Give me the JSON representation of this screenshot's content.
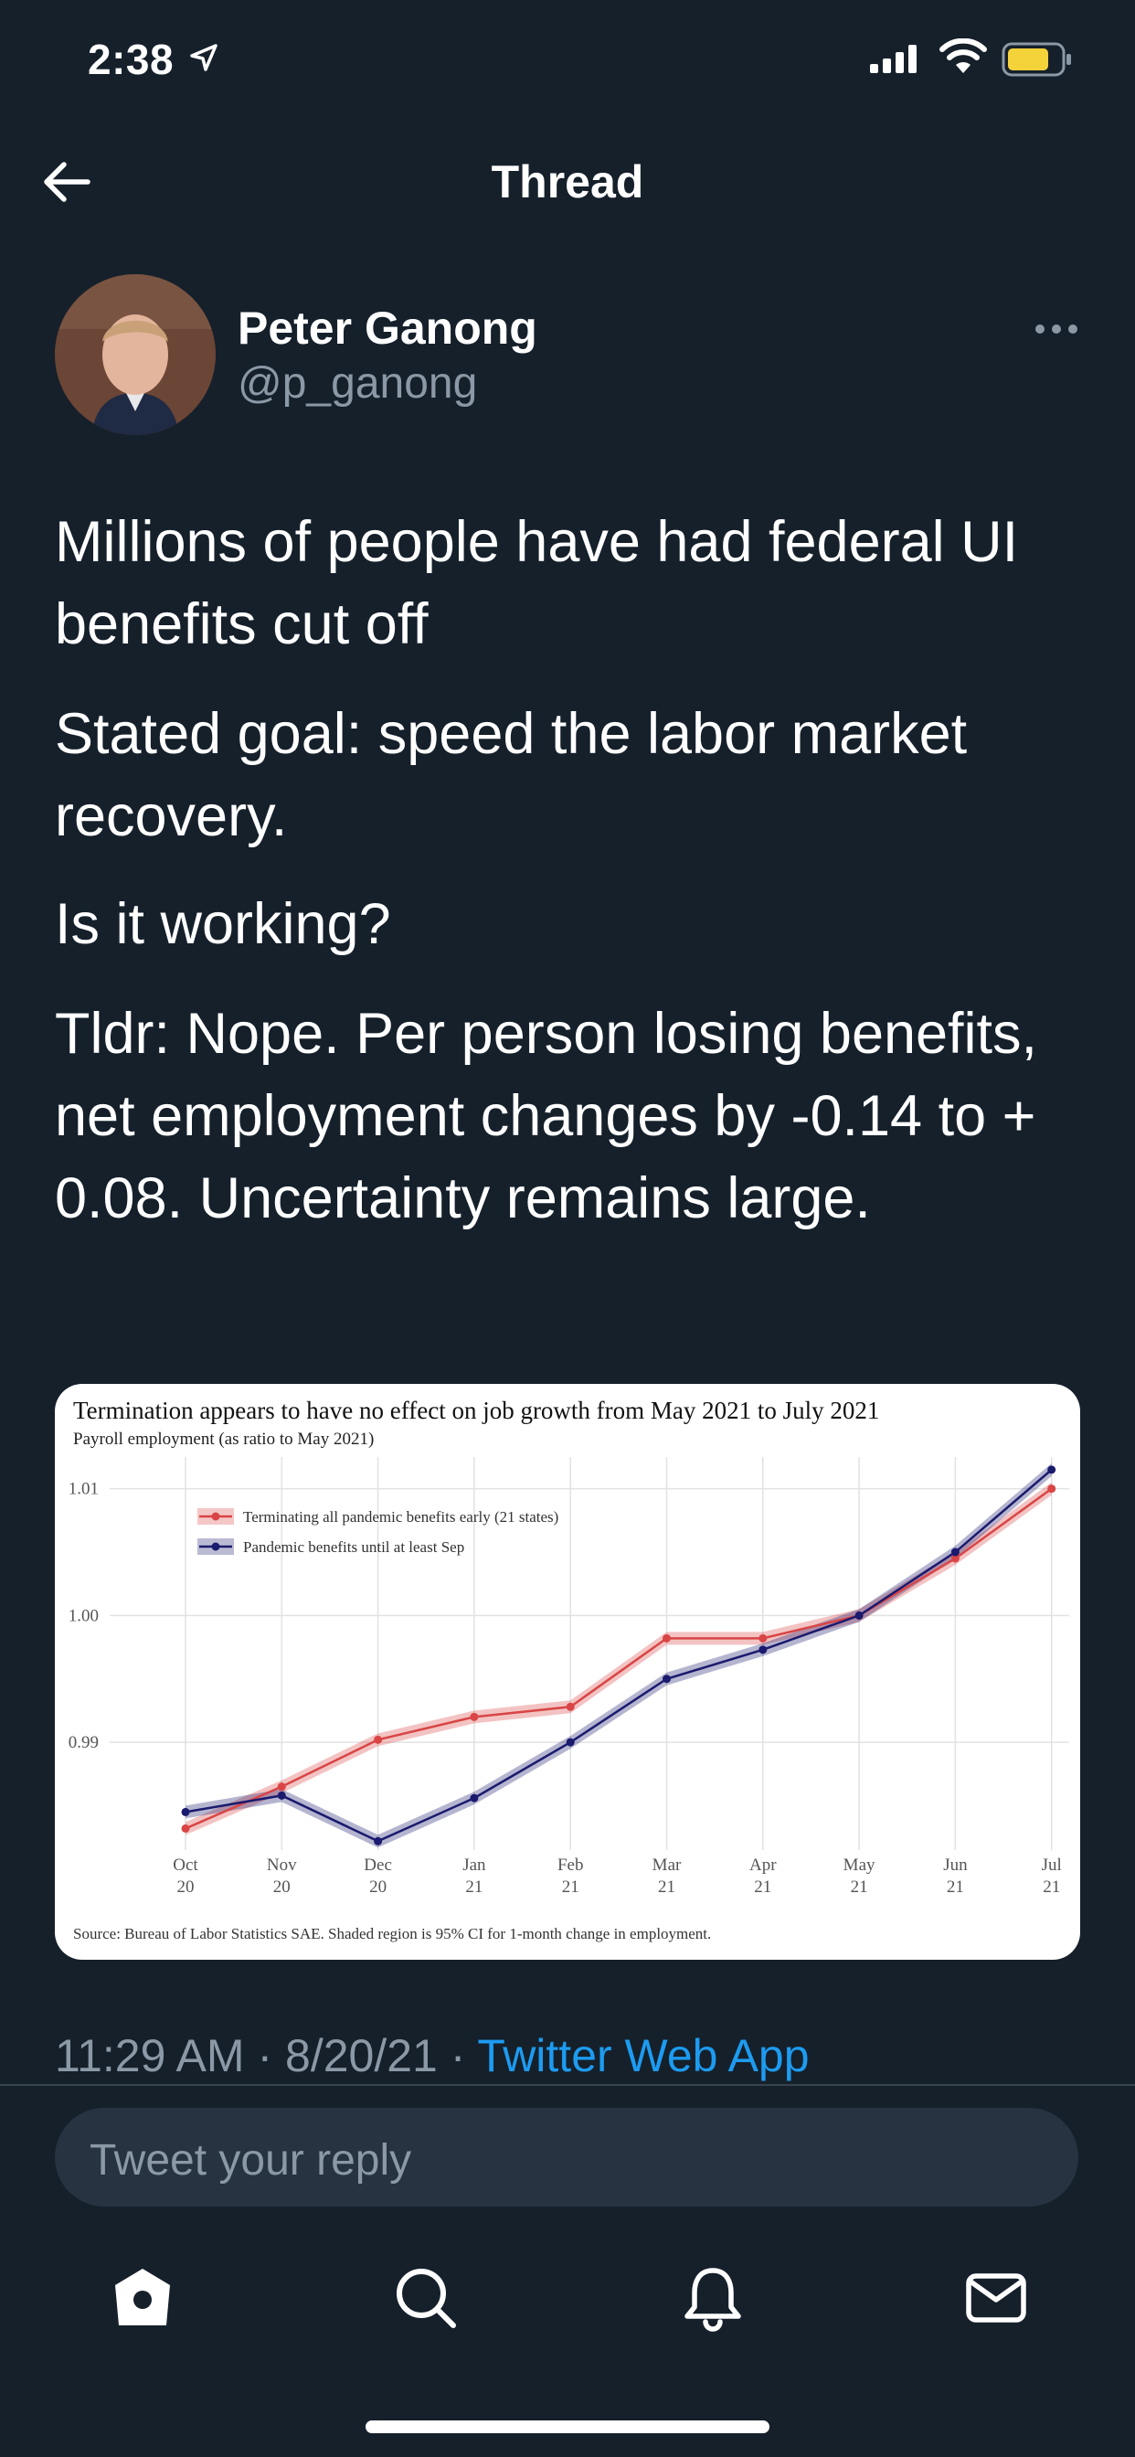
{
  "status_bar": {
    "time": "2:38"
  },
  "nav": {
    "title": "Thread"
  },
  "author": {
    "name": "Peter Ganong",
    "handle": "@p_ganong"
  },
  "tweet": {
    "paragraphs": [
      "Millions of people have had federal UI benefits cut off",
      "Stated goal: speed the labor market recovery.",
      "Is it working?",
      "Tldr: Nope. Per person losing benefits, net employment changes by -0.14 to + 0.08. Uncertainty remains large."
    ],
    "time": "11:29 AM",
    "date": "8/20/21",
    "source": "Twitter Web App"
  },
  "reply": {
    "placeholder": "Tweet your reply"
  },
  "tabs": [
    "home-icon",
    "search-icon",
    "notifications-icon",
    "messages-icon"
  ],
  "colors": {
    "background": "#15202b",
    "link": "#1d9bf0",
    "red_series": "#d94545",
    "blue_series": "#1a1a6e"
  },
  "chart_data": {
    "type": "line",
    "title": "Termination appears to have no effect on job growth from May 2021 to July 2021",
    "subtitle": "Payroll employment (as ratio to May 2021)",
    "source": "Source: Bureau of Labor Statistics SAE. Shaded region is 95% CI for 1-month change in employment.",
    "categories": [
      "Oct 20",
      "Nov 20",
      "Dec 20",
      "Jan 21",
      "Feb 21",
      "Mar 21",
      "Apr 21",
      "May 21",
      "Jun 21",
      "Jul 21"
    ],
    "category_lines": [
      [
        "Oct",
        "20"
      ],
      [
        "Nov",
        "20"
      ],
      [
        "Dec",
        "20"
      ],
      [
        "Jan",
        "21"
      ],
      [
        "Feb",
        "21"
      ],
      [
        "Mar",
        "21"
      ],
      [
        "Apr",
        "21"
      ],
      [
        "May",
        "21"
      ],
      [
        "Jun",
        "21"
      ],
      [
        "Jul",
        "21"
      ]
    ],
    "y_ticks": [
      "1.01",
      "1.00",
      "0.99"
    ],
    "ylim": [
      0.9815,
      1.0125
    ],
    "grid": true,
    "legend": "top-left",
    "series": [
      {
        "name": "Terminating all pandemic benefits early (21 states)",
        "color": "#d94545",
        "values": [
          0.9832,
          0.9865,
          0.9902,
          0.992,
          0.9928,
          0.9982,
          0.9982,
          1.0,
          1.0045,
          1.01
        ]
      },
      {
        "name": "Pandemic benefits until at least Sep",
        "color": "#1a1a6e",
        "values": [
          0.9845,
          0.9858,
          0.9822,
          0.9856,
          0.99,
          0.995,
          0.9973,
          1.0,
          1.005,
          1.0115
        ]
      }
    ]
  }
}
